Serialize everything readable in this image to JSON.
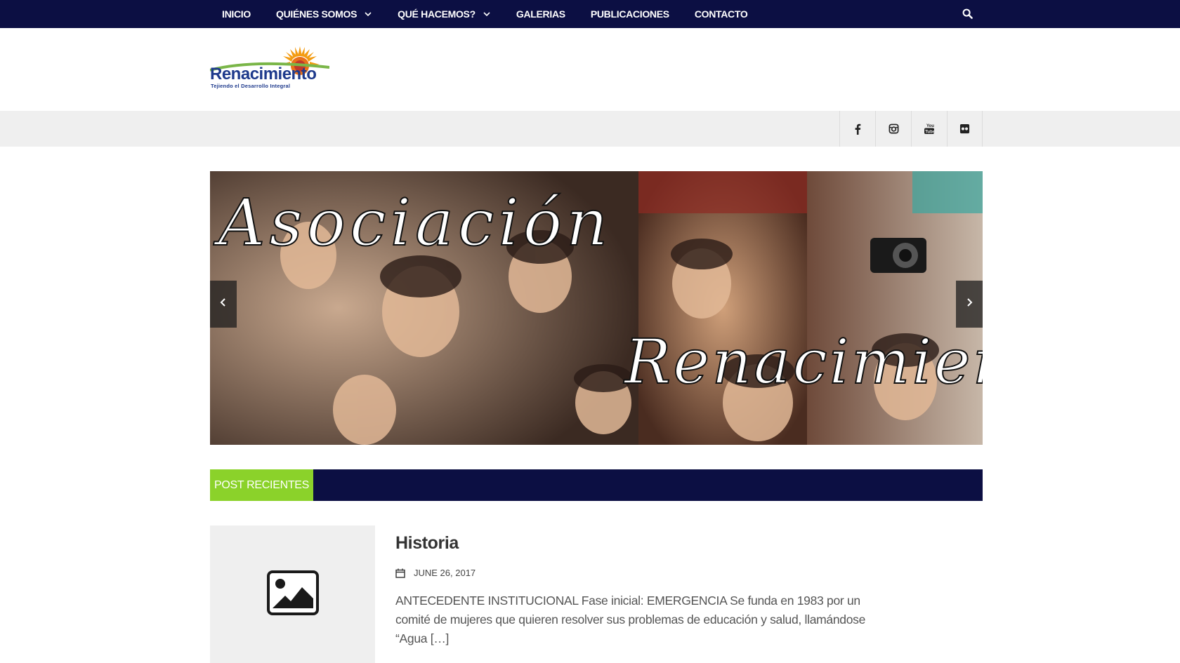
{
  "nav": {
    "items": [
      {
        "label": "INICIO",
        "has_dropdown": false
      },
      {
        "label": "QUIÉNES SOMOS",
        "has_dropdown": true
      },
      {
        "label": "QUÉ HACEMOS?",
        "has_dropdown": true
      },
      {
        "label": "GALERIAS",
        "has_dropdown": false
      },
      {
        "label": "PUBLICACIONES",
        "has_dropdown": false
      },
      {
        "label": "CONTACTO",
        "has_dropdown": false
      }
    ],
    "search_icon": "search-icon"
  },
  "logo": {
    "text": "Renacimiento",
    "subtitle": "Tejiendo el Desarrollo Integral"
  },
  "social": [
    "facebook-icon",
    "instagram-icon",
    "youtube-icon",
    "flickr-icon"
  ],
  "slider": {
    "line1": "Asociación",
    "line2": "Renacimiento"
  },
  "section": {
    "label": "POST RECIENTES"
  },
  "post": {
    "title": "Historia",
    "date": "JUNE 26, 2017",
    "excerpt": "ANTECEDENTE INSTITUCIONAL Fase inicial: EMERGENCIA Se funda en 1983 por un comité de mujeres que quieren resolver sus problemas de educación y salud, llamándose “Agua […]"
  },
  "colors": {
    "navy": "#0c0f43",
    "accent_green": "#8bd22a",
    "light_gray": "#efefef"
  }
}
